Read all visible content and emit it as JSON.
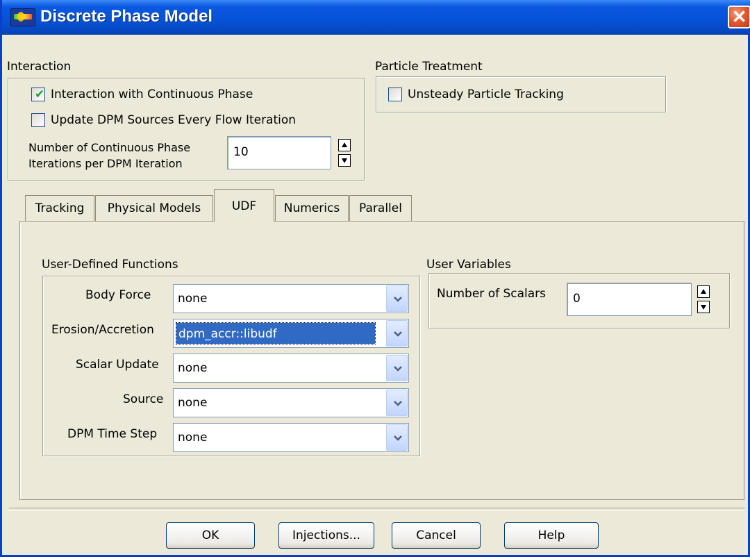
{
  "window": {
    "title": "Discrete Phase Model",
    "close_glyph": "✕"
  },
  "interaction": {
    "group_label": "Interaction",
    "interaction_with_continuous_phase": {
      "label": "Interaction with Continuous Phase",
      "checked": true
    },
    "update_dpm_sources": {
      "label": "Update DPM Sources Every Flow Iteration",
      "checked": false
    },
    "iterations_label_line1": "Number of Continuous Phase",
    "iterations_label_line2": "Iterations per DPM Iteration",
    "iterations_value": "10"
  },
  "particle_treatment": {
    "group_label": "Particle Treatment",
    "unsteady_particle_tracking": {
      "label": "Unsteady Particle Tracking",
      "checked": false
    }
  },
  "tabs": [
    {
      "label": "Tracking",
      "active": false
    },
    {
      "label": "Physical Models",
      "active": false
    },
    {
      "label": "UDF",
      "active": true
    },
    {
      "label": "Numerics",
      "active": false
    },
    {
      "label": "Parallel",
      "active": false
    }
  ],
  "udf": {
    "group_label": "User-Defined Functions",
    "body_force": {
      "label": "Body Force",
      "value": "none"
    },
    "erosion_accretion": {
      "label": "Erosion/Accretion",
      "value": "dpm_accr::libudf"
    },
    "scalar_update": {
      "label": "Scalar Update",
      "value": "none"
    },
    "source": {
      "label": "Source",
      "value": "none"
    },
    "dpm_time_step": {
      "label": "DPM Time Step",
      "value": "none"
    }
  },
  "user_variables": {
    "group_label": "User Variables",
    "number_of_scalars_label": "Number of Scalars",
    "number_of_scalars_value": "0"
  },
  "buttons": {
    "ok": "OK",
    "injections": "Injections...",
    "cancel": "Cancel",
    "help": "Help"
  },
  "colors": {
    "titlebar": "#0552d6",
    "dialog_bg": "#ece9d8",
    "selection": "#316ac5",
    "checkmark": "#21a121",
    "close_button": "#e35b33"
  }
}
